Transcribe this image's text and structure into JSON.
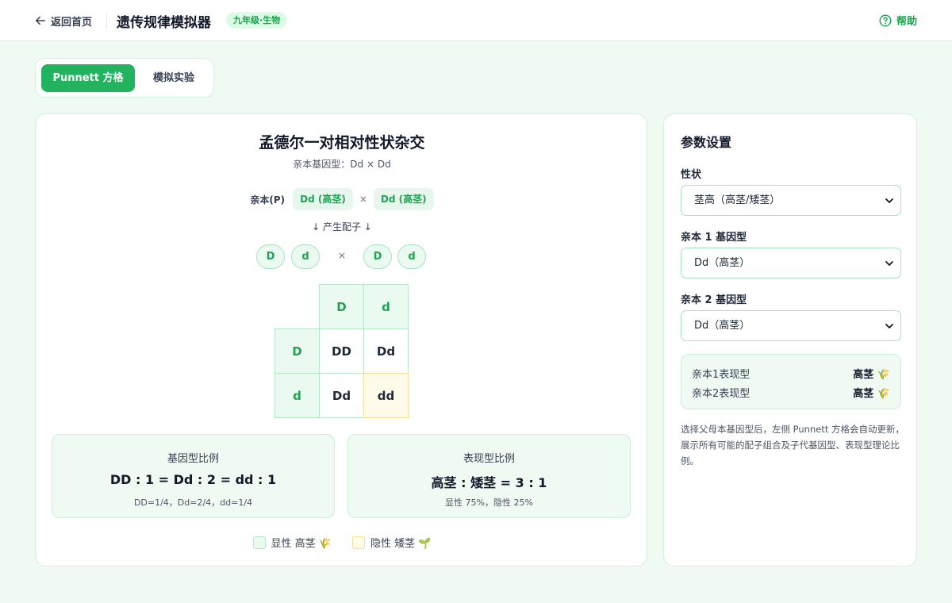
{
  "header": {
    "back_label": "返回首页",
    "title": "遗传规律模拟器",
    "badge": "九年级·生物",
    "help_label": "帮助"
  },
  "tabs": [
    {
      "label": "Punnett 方格",
      "active": true
    },
    {
      "label": "模拟实验",
      "active": false
    }
  ],
  "cross": {
    "title": "孟德尔一对相对性状杂交",
    "subtitle": "亲本基因型：Dd × Dd",
    "parents_label": "亲本(P)",
    "parent1": "Dd (高茎)",
    "parent2": "Dd (高茎)",
    "cross_symbol": "×",
    "gamete_caption": "↓ 产生配子 ↓",
    "gametes_p1": [
      "D",
      "d"
    ],
    "gametes_p2": [
      "D",
      "d"
    ]
  },
  "punnett": {
    "col_headers": [
      "D",
      "d"
    ],
    "row_headers": [
      "D",
      "d"
    ],
    "cells": [
      [
        "DD",
        "Dd"
      ],
      [
        "Dd",
        "dd"
      ]
    ],
    "recessive_cells": [
      "dd"
    ]
  },
  "ratios": {
    "genotype": {
      "title": "基因型比例",
      "main": "DD : 1 = Dd : 2 = dd : 1",
      "note": "DD=1/4，Dd=2/4，dd=1/4"
    },
    "phenotype": {
      "title": "表现型比例",
      "main": "高茎 : 矮茎 = 3 : 1",
      "note": "显性 75%，隐性 25%"
    }
  },
  "legend": {
    "dominant": "显性 高茎 🌾",
    "recessive": "隐性 矮茎 🌱"
  },
  "settings": {
    "title": "参数设置",
    "trait_label": "性状",
    "trait_value": "茎高（高茎/矮茎）",
    "parent1_label": "亲本 1 基因型",
    "parent1_value": "Dd（高茎）",
    "parent2_label": "亲本 2 基因型",
    "parent2_value": "Dd（高茎）",
    "phenotypes": [
      {
        "label": "亲本1表现型",
        "value": "高茎 🌾"
      },
      {
        "label": "亲本2表现型",
        "value": "高茎 🌾"
      }
    ],
    "description": "选择父母本基因型后，左侧 Punnett 方格会自动更新，展示所有可能的配子组合及子代基因型、表现型理论比例。"
  },
  "colors": {
    "accent": "#22b35e",
    "dominant_cell": "#eafaf0",
    "recessive_cell": "#fffbea"
  }
}
